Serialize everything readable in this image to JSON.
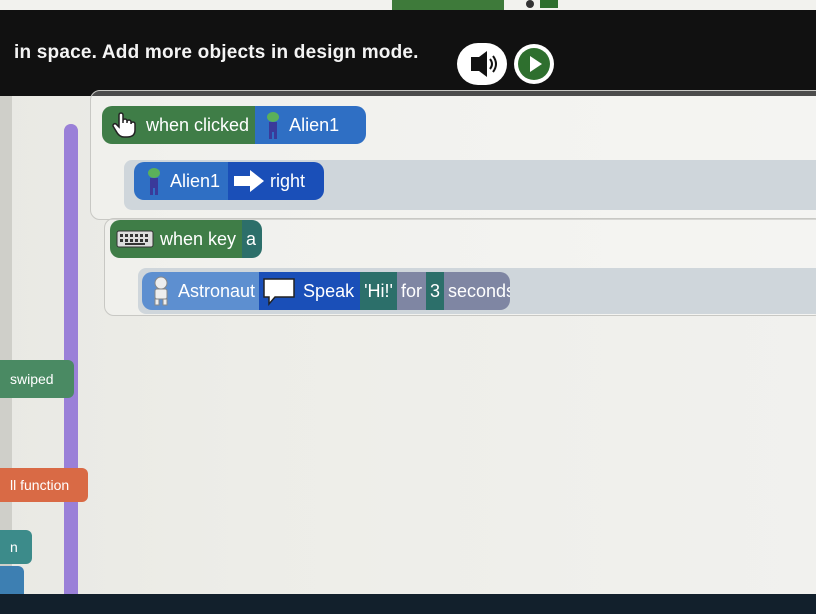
{
  "header": {
    "instruction": "in space. Add more objects in design mode."
  },
  "icons": {
    "sound": "sound-icon",
    "play": "play-icon",
    "hand": "hand-icon",
    "alien": "alien-icon",
    "arrow": "arrow-icon",
    "keyboard": "keyboard-icon",
    "astronaut": "astronaut-icon",
    "speech": "speech-bubble-icon"
  },
  "blocks": {
    "when_clicked": {
      "label": "when clicked",
      "object": "Alien1"
    },
    "move": {
      "object": "Alien1",
      "direction": "right"
    },
    "when_key": {
      "label": "when key",
      "key": "a"
    },
    "speak": {
      "object": "Astronaut",
      "action": "Speak",
      "text": "'Hi!'",
      "for": "for",
      "seconds_value": "3",
      "seconds_label": "seconds"
    }
  },
  "sidebar": {
    "items": [
      {
        "label": "swiped"
      },
      {
        "label": "ll function"
      },
      {
        "label": "n"
      }
    ]
  },
  "colors": {
    "event_green": "#3f7d47",
    "object_blue": "#2f6fc4",
    "action_blue": "#1a4fb8",
    "scrollbar_purple": "#9a80d8"
  }
}
